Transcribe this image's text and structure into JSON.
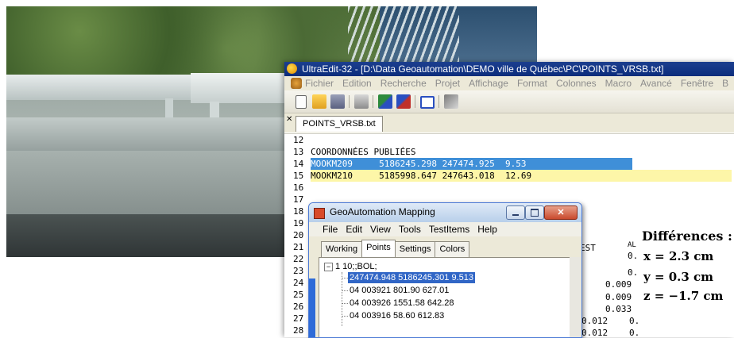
{
  "ultraedit": {
    "title": "UltraEdit-32 - [D:\\Data Geoautomation\\DEMO ville de Québec\\PC\\POINTS_VRSB.txt]",
    "menu": [
      "Fichier",
      "Edition",
      "Recherche",
      "Projet",
      "Affichage",
      "Format",
      "Colonnes",
      "Macro",
      "Avancé",
      "Fenêtre",
      "B"
    ],
    "tab": "POINTS_VRSB.txt",
    "lines": [
      {
        "n": "12",
        "text": ""
      },
      {
        "n": "13",
        "text": "COORDONNÉES PUBLIÉES"
      },
      {
        "n": "14",
        "text": "MOOKM209     5186245.298 247474.925  9.53"
      },
      {
        "n": "15",
        "text": "MOOKM210     5185998.647 247643.018  12.69"
      },
      {
        "n": "16",
        "text": ""
      },
      {
        "n": "17",
        "text": ""
      },
      {
        "n": "18",
        "text": ""
      },
      {
        "n": "19",
        "text": ""
      },
      {
        "n": "20",
        "text": ""
      },
      {
        "n": "21",
        "text": ""
      },
      {
        "n": "22",
        "text": ""
      },
      {
        "n": "23",
        "text": ""
      },
      {
        "n": "24",
        "text": ""
      },
      {
        "n": "25",
        "text": ""
      },
      {
        "n": "26",
        "text": ""
      },
      {
        "n": "27",
        "text": ""
      },
      {
        "n": "28",
        "text": ""
      }
    ],
    "fragments": [
      "EST",
      "AL",
      "0.",
      "0.",
      "0.009",
      "0.009",
      "0.033",
      "0.012",
      "0.",
      "0.012",
      "0."
    ],
    "differences": {
      "title": "Différences :",
      "x": "x = 2.3 cm",
      "y": "y = 0.3 cm",
      "z": "z = −1.7 cm"
    }
  },
  "geoautomation": {
    "title": "GeoAutomation Mapping",
    "menu": [
      "File",
      "Edit",
      "View",
      "Tools",
      "TestItems",
      "Help"
    ],
    "tabs": [
      "Working",
      "Points",
      "Settings",
      "Colors"
    ],
    "active_tab": "Points",
    "tree": {
      "root_label": "1  10;;BOL;",
      "expander": "−",
      "children": [
        "247474.948 5186245.301 9.513",
        "04 003921 801.90 627.01",
        "04 003926 1551.58 642.28",
        "04 003916 58.60 612.83"
      ]
    }
  },
  "colors": {
    "highlight_blue": "#3f8fd8",
    "highlight_yellow": "#fdf6a8",
    "title_blue": "#0b2d7c",
    "tree_selected": "#3166c6"
  }
}
